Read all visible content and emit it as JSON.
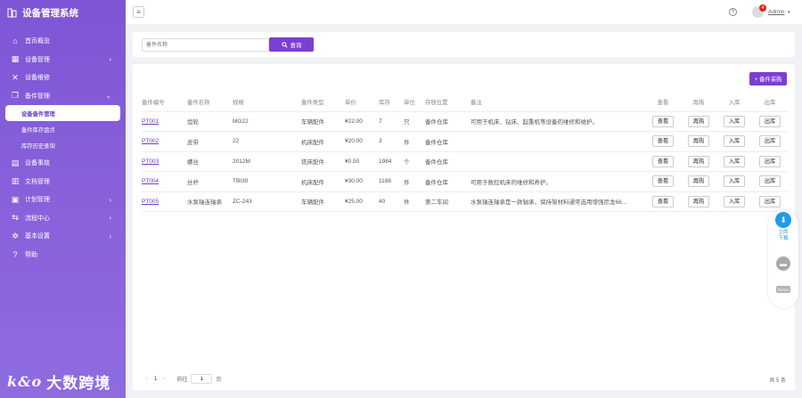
{
  "app": {
    "title": "设备管理系统",
    "logo_text": "大数跨境",
    "logo_mark": "k&o"
  },
  "sidebar": {
    "items": [
      {
        "label": "首页概览",
        "icon": "home-icon",
        "glyph": "⌂"
      },
      {
        "label": "设备管理",
        "icon": "grid-icon",
        "glyph": "▦",
        "chevron": "›"
      },
      {
        "label": "设备维修",
        "icon": "tools-icon",
        "glyph": "✕"
      },
      {
        "label": "备件管理",
        "icon": "copy-icon",
        "glyph": "❐",
        "chevron": "⌄"
      },
      {
        "label": "设备事故",
        "icon": "document-icon",
        "glyph": "▤"
      },
      {
        "label": "文档管理",
        "icon": "file-icon",
        "glyph": "▥"
      },
      {
        "label": "计划管理",
        "icon": "calendar-icon",
        "glyph": "▣",
        "chevron": "›"
      },
      {
        "label": "流程中心",
        "icon": "flow-icon",
        "glyph": "⇆",
        "chevron": "›"
      },
      {
        "label": "基本设置",
        "icon": "gear-icon",
        "glyph": "✲",
        "chevron": "›"
      },
      {
        "label": "帮助",
        "icon": "help-circle-icon",
        "glyph": "?"
      }
    ],
    "sub_items": [
      {
        "label": "设备备件管理",
        "active": true
      },
      {
        "label": "备件库存盘点"
      },
      {
        "label": "库存历史查询"
      }
    ]
  },
  "topbar": {
    "menu_glyph": "≡",
    "help_glyph": "?",
    "badge_count": "4",
    "user": "Admin",
    "caret": "▾"
  },
  "search": {
    "placeholder": "备件名称",
    "button_label": "查询"
  },
  "toolbar": {
    "purchase_label": "+ 备件采购"
  },
  "table": {
    "headers": [
      "备件编号",
      "备件名称",
      "规格",
      "备件类型",
      "单价",
      "库存",
      "单位",
      "存放位置",
      "备注",
      "查看",
      "再购",
      "入库",
      "出库"
    ],
    "rows": [
      {
        "id": "PT001",
        "name": "齿轮",
        "spec": "MG22",
        "type": "车辆配件",
        "price": "¥22.00",
        "stock": "7",
        "unit": "只",
        "location": "备件仓库",
        "note": "可用于机床、钻床、起重机等设备的维修和维护。"
      },
      {
        "id": "PT002",
        "name": "皮带",
        "spec": "22",
        "type": "机床配件",
        "price": "¥20.00",
        "stock": "3",
        "unit": "件",
        "location": "备件仓库",
        "note": ""
      },
      {
        "id": "PT003",
        "name": "螺丝",
        "spec": "2012M",
        "type": "铣床配件",
        "price": "¥0.50",
        "stock": "1984",
        "unit": "个",
        "location": "备件仓库",
        "note": ""
      },
      {
        "id": "PT004",
        "name": "丝杆",
        "spec": "TBI30",
        "type": "机床配件",
        "price": "¥30.00",
        "stock": "1188",
        "unit": "件",
        "location": "备件仓库",
        "note": "可用于数控机床的维修和养护。"
      },
      {
        "id": "PT005",
        "name": "水泵轴连轴承",
        "spec": "ZC-243",
        "type": "车辆配件",
        "price": "¥25.00",
        "stock": "40",
        "unit": "件",
        "location": "第二车间",
        "note": "水泵轴连轴承是一款轴承，保持架材料通常选用增强尼龙66..."
      }
    ],
    "action_labels": {
      "view": "查看",
      "rebuy": "再购",
      "stock_in": "入库",
      "stock_out": "出库"
    }
  },
  "pagination": {
    "prev": "‹",
    "current": "1",
    "next": "›",
    "goto_label": "前往",
    "goto_value": "1",
    "page_suffix": "页",
    "total": "共 5 条"
  },
  "float": {
    "download_line1": "立即",
    "download_line2": "下载",
    "demo_label": "Demo"
  },
  "colors": {
    "sidebar": "#7e56d6",
    "accent": "#7b3fd1",
    "badge": "#e2231a",
    "download": "#1e9ce8"
  }
}
